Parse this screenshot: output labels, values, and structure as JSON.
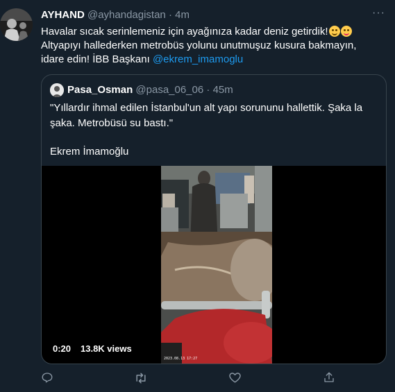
{
  "tweet": {
    "display_name": "AYHAND",
    "handle": "@ayhandagistan",
    "separator": "·",
    "time": "4m",
    "text_line1": "Havalar sıcak serinlemeniz için ayağınıza kadar deniz getirdik!",
    "text_rest": "Altyapıyı hallederken metrobüs yolunu unutmuşuz kusura bakmayın, idare edin! İBB Başkanı ",
    "mention": "@ekrem_imamoglu",
    "emojis": [
      "grinning-face-icon",
      "face-savoring-food-icon"
    ]
  },
  "quote": {
    "display_name": "Pasa_Osman",
    "handle": "@pasa_06_06",
    "separator": "·",
    "time": "45m",
    "text": "\"Yıllardır ihmal edilen İstanbul'un alt yapı sorununu hallettik. Şaka la şaka. Metrobüsü su bastı.\"",
    "signature": "Ekrem İmamoğlu",
    "video": {
      "elapsed": "0:20",
      "views": "13.8K views",
      "watermark": "2023.08.13 17:27"
    }
  },
  "actions": [
    {
      "name": "reply",
      "icon": "reply-icon"
    },
    {
      "name": "retweet",
      "icon": "retweet-icon"
    },
    {
      "name": "like",
      "icon": "heart-icon"
    },
    {
      "name": "share",
      "icon": "share-icon"
    }
  ],
  "colors": {
    "background": "#15202b",
    "border": "#38444d",
    "muted_text": "#8b98a5",
    "mention": "#1d9bf0"
  }
}
